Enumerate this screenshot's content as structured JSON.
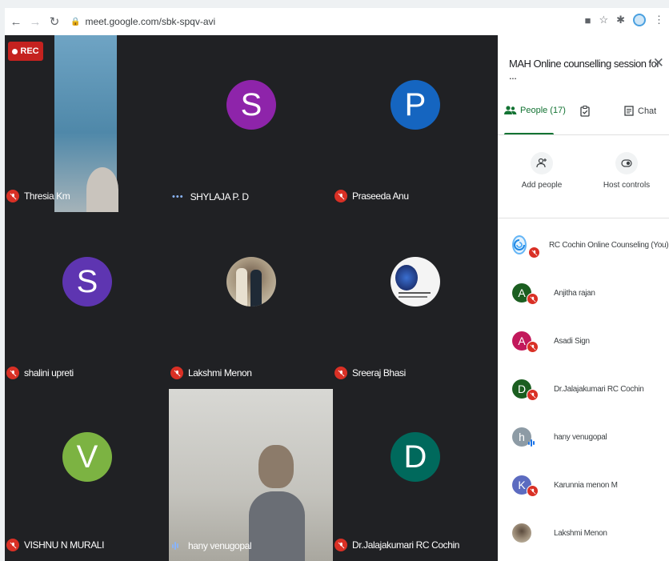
{
  "browser": {
    "url": "meet.google.com/sbk-spqv-avi"
  },
  "recording": {
    "label": "REC"
  },
  "tiles": [
    {
      "name": "Thresia Km",
      "state": "muted",
      "kind": "video"
    },
    {
      "name": "SHYLAJA P. D",
      "state": "dots",
      "kind": "avatar",
      "letter": "S",
      "color": "#8e24aa"
    },
    {
      "name": "Praseeda Anu",
      "state": "muted",
      "kind": "avatar",
      "letter": "P",
      "color": "#1565c0"
    },
    {
      "name": "shalini upreti",
      "state": "muted",
      "kind": "avatar",
      "letter": "S",
      "color": "#5e35b1"
    },
    {
      "name": "Lakshmi Menon",
      "state": "muted",
      "kind": "photo"
    },
    {
      "name": "Sreeraj Bhasi",
      "state": "muted",
      "kind": "photo"
    },
    {
      "name": "VISHNU N MURALI",
      "state": "muted",
      "kind": "avatar",
      "letter": "V",
      "color": "#7cb342"
    },
    {
      "name": "hany venugopal",
      "state": "speaking",
      "kind": "video"
    },
    {
      "name": "Dr.Jalajakumari RC Cochin",
      "state": "muted",
      "kind": "avatar",
      "letter": "D",
      "color": "#00695c"
    }
  ],
  "panel": {
    "title": "MAH Online counselling session for ...",
    "tabs": {
      "people": "People (17)",
      "chat": "Chat"
    },
    "actions": {
      "add_people": "Add people",
      "host_controls": "Host controls"
    },
    "people": [
      {
        "name": "RC Cochin Online Counseling (You)",
        "kind": "logo",
        "state": "muted"
      },
      {
        "name": "Anjitha rajan",
        "kind": "avatar",
        "letter": "A",
        "color": "#1b5e20",
        "state": "muted"
      },
      {
        "name": "Asadi Sign",
        "kind": "avatar",
        "letter": "A",
        "color": "#c2185b",
        "state": "muted"
      },
      {
        "name": "Dr.Jalajakumari RC Cochin",
        "kind": "avatar",
        "letter": "D",
        "color": "#1b5e20",
        "state": "muted"
      },
      {
        "name": "hany venugopal",
        "kind": "avatar",
        "letter": "h",
        "color": "#8d9ba5",
        "state": "speaking"
      },
      {
        "name": "Karunnia menon M",
        "kind": "avatar",
        "letter": "K",
        "color": "#5c6bc0",
        "state": "muted"
      },
      {
        "name": "Lakshmi Menon",
        "kind": "photo",
        "state": "none"
      }
    ]
  }
}
